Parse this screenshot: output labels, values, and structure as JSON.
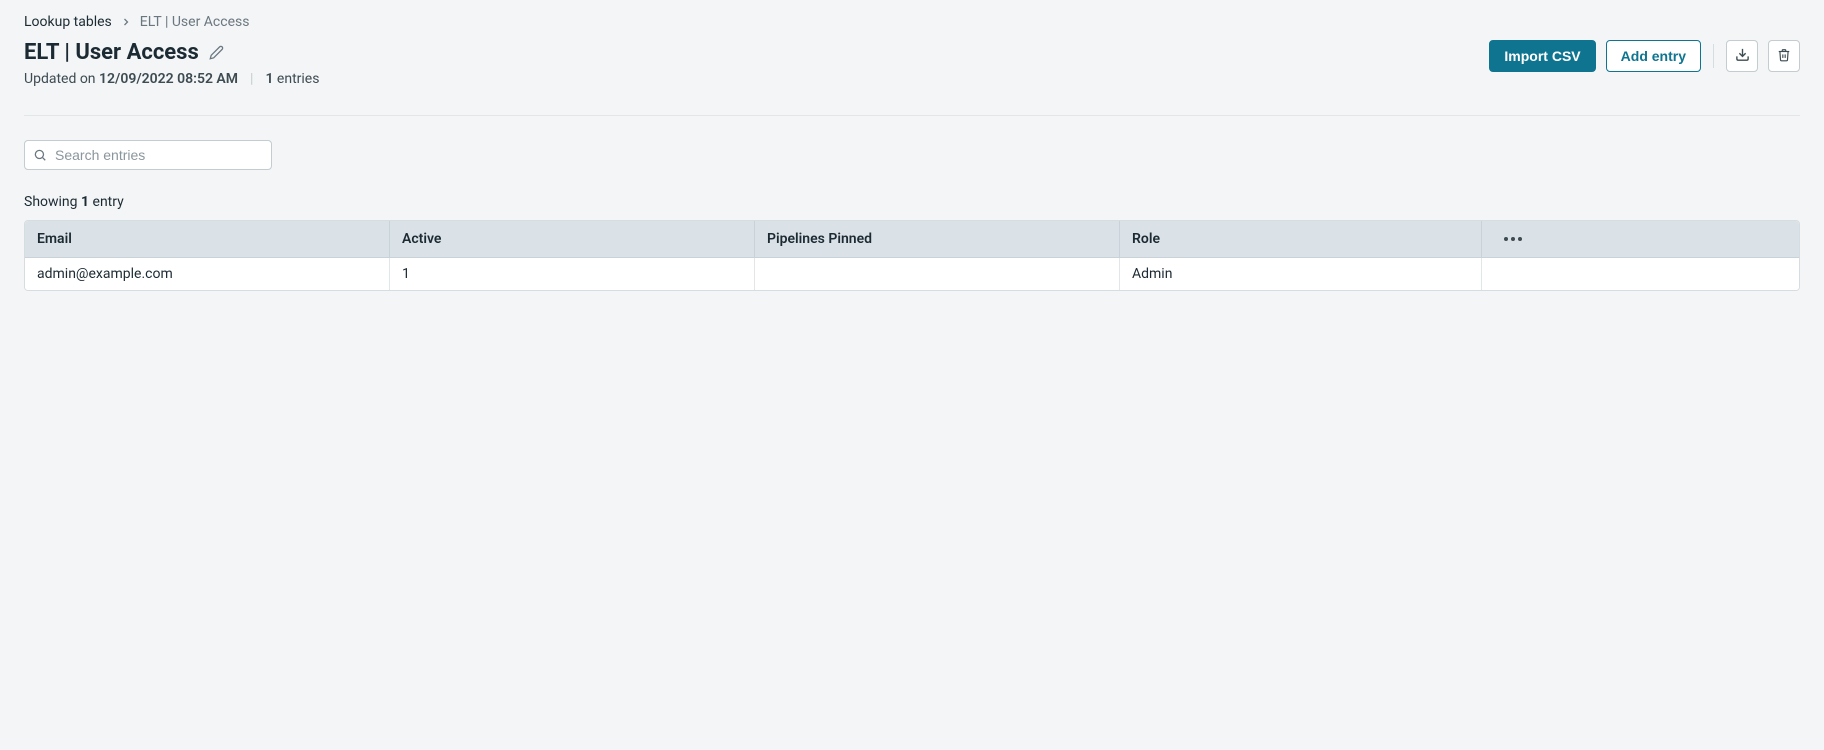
{
  "breadcrumb": {
    "root": "Lookup tables",
    "current": "ELT | User Access"
  },
  "page": {
    "title": "ELT | User Access",
    "updated_label": "Updated on ",
    "updated_value": "12/09/2022 08:52 AM",
    "entries_count": "1",
    "entries_label": " entries"
  },
  "actions": {
    "import_csv": "Import CSV",
    "add_entry": "Add entry"
  },
  "search": {
    "placeholder": "Search entries"
  },
  "showing": {
    "prefix": "Showing ",
    "count": "1",
    "suffix": " entry"
  },
  "table": {
    "headers": {
      "email": "Email",
      "active": "Active",
      "pipelines_pinned": "Pipelines Pinned",
      "role": "Role"
    },
    "rows": [
      {
        "email": "admin@example.com",
        "active": "1",
        "pipelines_pinned": "",
        "role": "Admin"
      }
    ]
  }
}
